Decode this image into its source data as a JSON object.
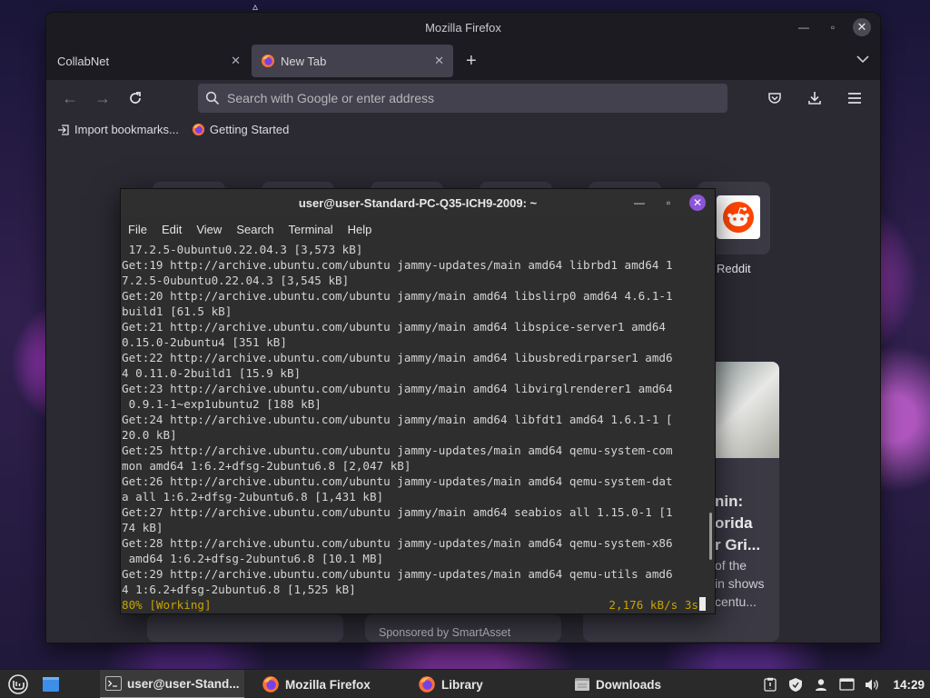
{
  "firefox": {
    "window_title": "Mozilla Firefox",
    "tabs": [
      {
        "label": "CollabNet",
        "active": false
      },
      {
        "label": "New Tab",
        "active": true
      }
    ],
    "url_placeholder": "Search with Google or enter address",
    "bookmarks": [
      "Import bookmarks...",
      "Getting Started"
    ],
    "shortcuts": [
      {
        "label": "Reddit"
      }
    ],
    "story": {
      "title_lines": [
        "nin:",
        "orida",
        "r Gri..."
      ],
      "excerpt_lines": [
        "of the",
        "in shows",
        "centu..."
      ]
    },
    "sponsored": "Sponsored by SmartAsset"
  },
  "terminal": {
    "title": "user@user-Standard-PC-Q35-ICH9-2009: ~",
    "menu": [
      "File",
      "Edit",
      "View",
      "Search",
      "Terminal",
      "Help"
    ],
    "lines": [
      " 17.2.5-0ubuntu0.22.04.3 [3,573 kB]",
      "Get:19 http://archive.ubuntu.com/ubuntu jammy-updates/main amd64 librbd1 amd64 1",
      "7.2.5-0ubuntu0.22.04.3 [3,545 kB]",
      "Get:20 http://archive.ubuntu.com/ubuntu jammy/main amd64 libslirp0 amd64 4.6.1-1",
      "build1 [61.5 kB]",
      "Get:21 http://archive.ubuntu.com/ubuntu jammy/main amd64 libspice-server1 amd64",
      "0.15.0-2ubuntu4 [351 kB]",
      "Get:22 http://archive.ubuntu.com/ubuntu jammy/main amd64 libusbredirparser1 amd6",
      "4 0.11.0-2build1 [15.9 kB]",
      "Get:23 http://archive.ubuntu.com/ubuntu jammy/main amd64 libvirglrenderer1 amd64",
      " 0.9.1-1~exp1ubuntu2 [188 kB]",
      "Get:24 http://archive.ubuntu.com/ubuntu jammy/main amd64 libfdt1 amd64 1.6.1-1 [",
      "20.0 kB]",
      "Get:25 http://archive.ubuntu.com/ubuntu jammy-updates/main amd64 qemu-system-com",
      "mon amd64 1:6.2+dfsg-2ubuntu6.8 [2,047 kB]",
      "Get:26 http://archive.ubuntu.com/ubuntu jammy-updates/main amd64 qemu-system-dat",
      "a all 1:6.2+dfsg-2ubuntu6.8 [1,431 kB]",
      "Get:27 http://archive.ubuntu.com/ubuntu jammy/main amd64 seabios all 1.15.0-1 [1",
      "74 kB]",
      "Get:28 http://archive.ubuntu.com/ubuntu jammy-updates/main amd64 qemu-system-x86",
      " amd64 1:6.2+dfsg-2ubuntu6.8 [10.1 MB]",
      "Get:29 http://archive.ubuntu.com/ubuntu jammy-updates/main amd64 qemu-utils amd6",
      "4 1:6.2+dfsg-2ubuntu6.8 [1,525 kB]"
    ],
    "status_left": "80% [Working]",
    "status_right": "2,176 kB/s 3s"
  },
  "taskbar": {
    "tasks": [
      {
        "label": "user@user-Stand...",
        "icon": "terminal-icon",
        "active": true
      },
      {
        "label": "Mozilla Firefox",
        "icon": "firefox-icon",
        "active": false
      },
      {
        "label": "Library",
        "icon": "firefox-icon",
        "active": false
      },
      {
        "label": "Downloads",
        "icon": "folder-icon",
        "active": false
      }
    ],
    "clock": "14:29"
  },
  "colors": {
    "terminal_status": "#c8a400",
    "terminal_close": "#8a55d6",
    "reddit": "#ff4500",
    "active_task_underline": "#9d7fd8"
  }
}
